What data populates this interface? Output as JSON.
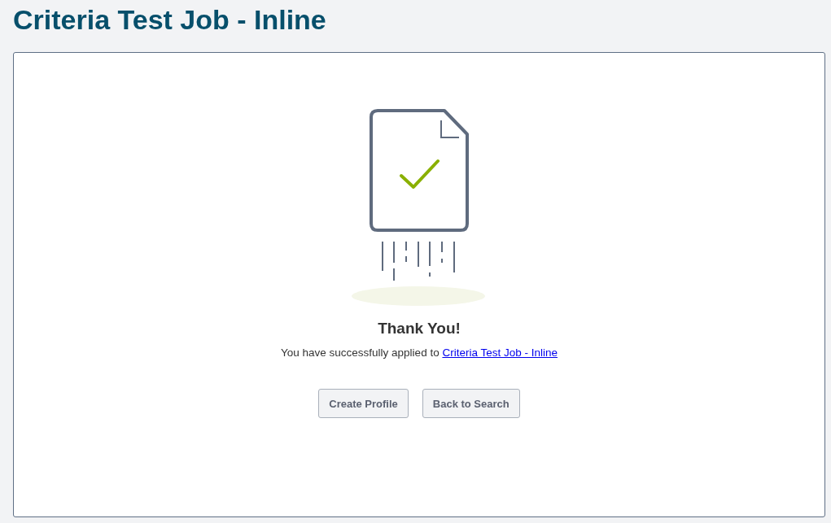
{
  "page_title": "Criteria Test Job - Inline",
  "confirmation": {
    "heading": "Thank You!",
    "message": "You have successfully applied to",
    "link": "Criteria Test Job - Inline"
  },
  "buttons": [
    "Create Profile",
    "Back to Search"
  ]
}
